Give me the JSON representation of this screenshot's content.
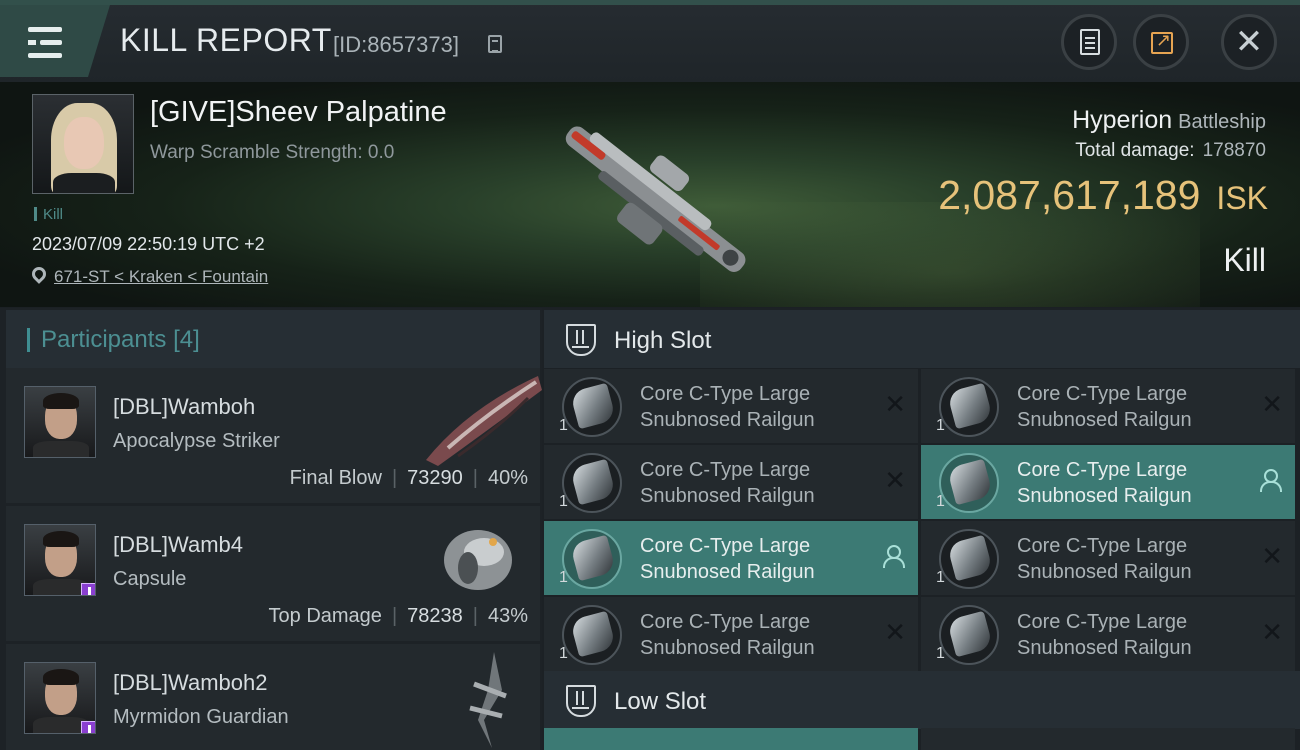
{
  "header": {
    "title": "KILL REPORT",
    "report_id": "[ID:8657373]",
    "icons": [
      "menu-icon",
      "clipboard-icon",
      "share-icon",
      "close-icon"
    ],
    "accent_color": "#e6a452"
  },
  "victim": {
    "name": "[GIVE]Sheev Palpatine",
    "warp_scramble": "Warp Scramble Strength: 0.0",
    "tag": "Kill",
    "datetime": "2023/07/09 22:50:19 UTC +2",
    "location": "671-ST < Kraken < Fountain",
    "ship_name": "Hyperion",
    "ship_class": "Battleship",
    "total_damage_label": "Total damage:",
    "total_damage": "178870",
    "isk_value": "2,087,617,189",
    "isk_unit": "ISK",
    "result": "Kill",
    "isk_color": "#e6c27a"
  },
  "participants": {
    "label": "Participants",
    "count": "[4]",
    "rows": [
      {
        "name": "[DBL]Wamboh",
        "ship": "Apocalypse Striker",
        "stat_label": "Final Blow",
        "damage": "73290",
        "percent": "40%",
        "badge": false
      },
      {
        "name": "[DBL]Wamb4",
        "ship": "Capsule",
        "stat_label": "Top Damage",
        "damage": "78238",
        "percent": "43%",
        "badge": true
      },
      {
        "name": "[DBL]Wamboh2",
        "ship": "Myrmidon Guardian",
        "stat_label": "",
        "damage": "",
        "percent": "",
        "badge": true
      }
    ]
  },
  "slots": {
    "high_label": "High Slot",
    "low_label": "Low Slot",
    "high_items": [
      {
        "qty": "1",
        "line1": "Core C-Type Large",
        "line2": "Snubnosed Railgun",
        "state": "destroyed"
      },
      {
        "qty": "1",
        "line1": "Core C-Type Large",
        "line2": "Snubnosed Railgun",
        "state": "destroyed"
      },
      {
        "qty": "1",
        "line1": "Core C-Type Large",
        "line2": "Snubnosed Railgun",
        "state": "destroyed"
      },
      {
        "qty": "1",
        "line1": "Core C-Type Large",
        "line2": "Snubnosed Railgun",
        "state": "dropped"
      },
      {
        "qty": "1",
        "line1": "Core C-Type Large",
        "line2": "Snubnosed Railgun",
        "state": "dropped"
      },
      {
        "qty": "1",
        "line1": "Core C-Type Large",
        "line2": "Snubnosed Railgun",
        "state": "destroyed"
      },
      {
        "qty": "1",
        "line1": "Core C-Type Large",
        "line2": "Snubnosed Railgun",
        "state": "destroyed"
      },
      {
        "qty": "1",
        "line1": "Core C-Type Large",
        "line2": "Snubnosed Railgun",
        "state": "destroyed"
      }
    ]
  }
}
